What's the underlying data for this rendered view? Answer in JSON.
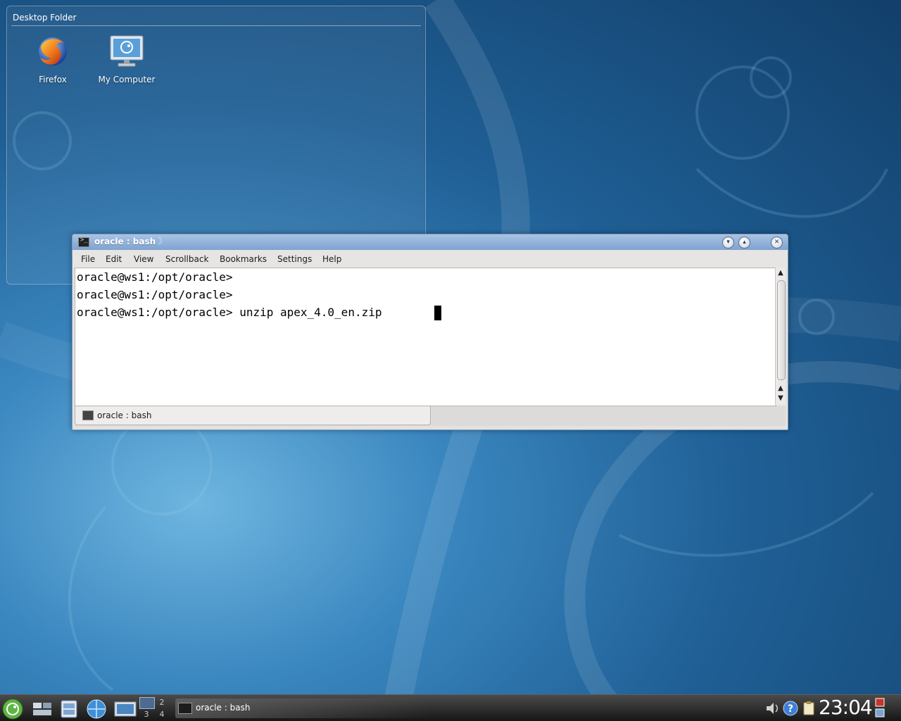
{
  "desktop": {
    "folder_view": {
      "title": "Desktop Folder",
      "icons": [
        {
          "label": "Firefox",
          "icon": "firefox-icon"
        },
        {
          "label": "My Computer",
          "icon": "computer-icon"
        }
      ]
    }
  },
  "window": {
    "title": "oracle : bash",
    "buttons": {
      "minimize": "minimize-icon",
      "maximize": "maximize-icon",
      "close": "close-icon"
    },
    "menu": [
      "File",
      "Edit",
      "View",
      "Scrollback",
      "Bookmarks",
      "Settings",
      "Help"
    ],
    "terminal": {
      "lines": [
        "oracle@ws1:/opt/oracle>",
        "oracle@ws1:/opt/oracle>",
        "oracle@ws1:/opt/oracle> unzip apex_4.0_en.zip "
      ]
    },
    "tab": {
      "label": "oracle : bash",
      "icon": "terminal-icon"
    }
  },
  "taskbar": {
    "launchers": [
      "kickoff-menu-icon",
      "show-desktop-icon",
      "file-manager-icon",
      "web-browser-icon",
      "system-icon"
    ],
    "pager": [
      "1",
      "2",
      "3",
      "4"
    ],
    "task": {
      "label": "oracle : bash",
      "icon": "terminal-icon"
    },
    "tray": [
      "volume-icon",
      "help-icon",
      "clipboard-icon",
      "network-icon"
    ],
    "clock": "23:04",
    "colors": {
      "accent": "#7fa3d0",
      "desktop": "#1f5f95"
    }
  }
}
